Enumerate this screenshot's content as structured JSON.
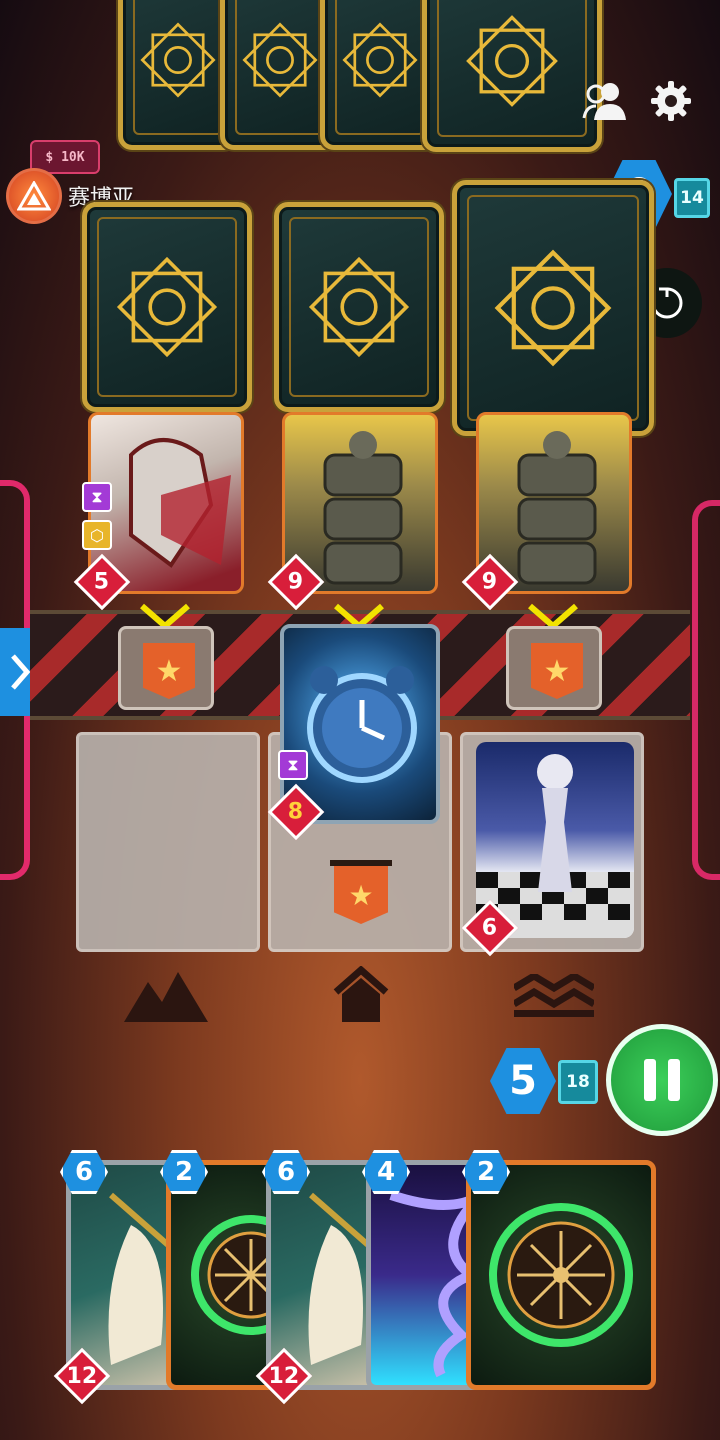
{
  "opponent": {
    "name": "赛博亚",
    "energy": "0",
    "deck_count": "14"
  },
  "player": {
    "energy": "5",
    "deck_count": "18"
  },
  "board": {
    "opponent_cards": [
      {
        "power": "5",
        "tags": [
          "hourglass",
          "hexagon"
        ]
      },
      {
        "power": "9"
      },
      {
        "power": "9"
      }
    ],
    "player_cards": [
      {
        "power": "8",
        "tags": [
          "hourglass"
        ]
      },
      {
        "power": "6"
      }
    ]
  },
  "hand": [
    {
      "cost": "6",
      "power": "12"
    },
    {
      "cost": "2"
    },
    {
      "cost": "6",
      "power": "12"
    },
    {
      "cost": "4"
    },
    {
      "cost": "2"
    }
  ],
  "icons": {
    "friends": "friends-icon",
    "settings": "gear-icon",
    "undo": "undo-icon",
    "pause": "pause-icon",
    "menu": "chevron-right-icon"
  },
  "colors": {
    "energy_blue": "#1e90e0",
    "card_gold": "#c9a23a",
    "power_red": "#d81e3a",
    "pause_green": "#2bb34a"
  }
}
